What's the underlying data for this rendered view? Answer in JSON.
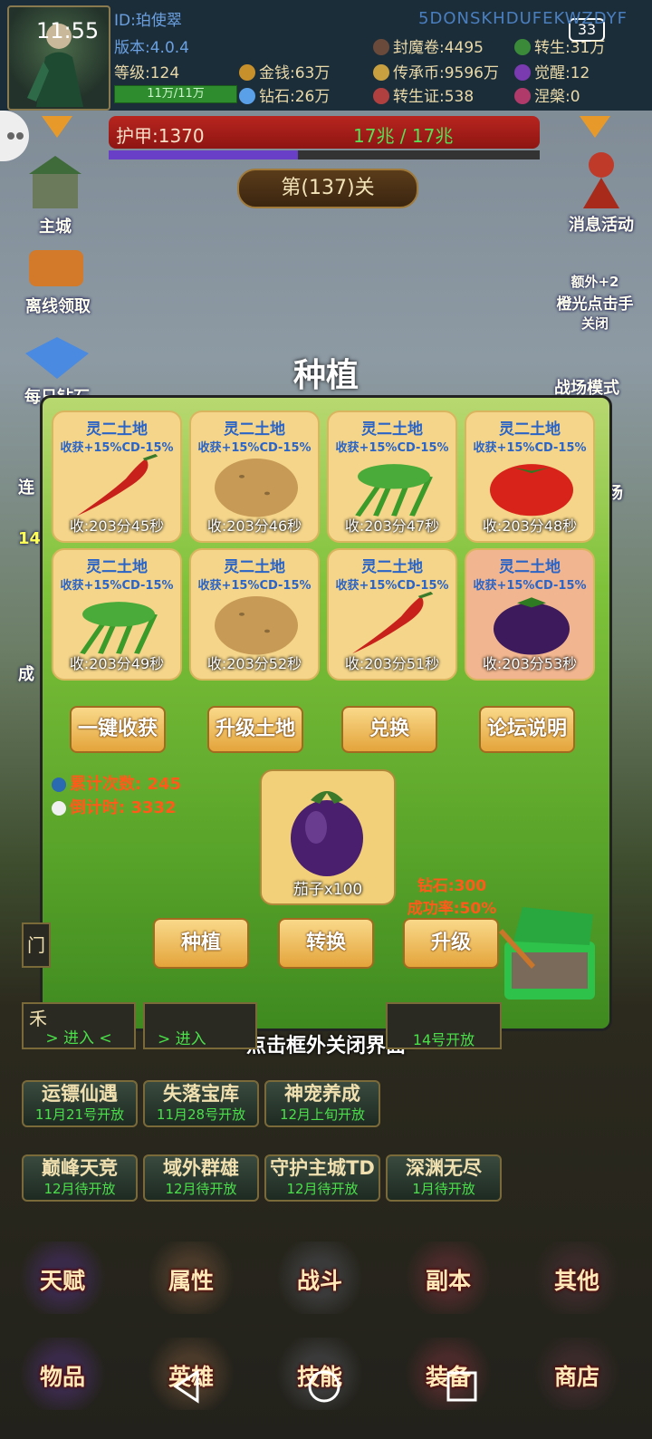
{
  "status_bar": {
    "time": "11:55",
    "battery": "33"
  },
  "player": {
    "id": "ID:珀使翠",
    "uid_code": "5DONSKHDUFEKWZDYF",
    "version": "版本:4.0.4",
    "level": "等级:124",
    "exp": "11万/11万",
    "money": "金钱:63万",
    "diamond": "钻石:26万",
    "seal_scroll": "封魔卷:4495",
    "inherit_coin": "传承币:9596万",
    "rebirth_cert": "转生证:538",
    "rebirth": "转生:31万",
    "awaken": "觉醒:12",
    "nirvana": "涅槃:0"
  },
  "armor": {
    "label": "护甲:1370",
    "hp": "17兆 / 17兆",
    "fill_fraction": 0.44
  },
  "stage": "第(137)关",
  "side_left": [
    "主城",
    "离线领取",
    "每日钻石",
    "连",
    "14",
    "成"
  ],
  "side_right": [
    "消息活动",
    "额外+2",
    "橙光点击手",
    "关闭",
    "战场模式",
    "场"
  ],
  "dialog": {
    "title": "种植",
    "plots": [
      {
        "title": "灵二土地",
        "bonus": "收获+15%CD-15%",
        "time": "收:203分45秒",
        "crop": "chili",
        "bg": "#f4d58a"
      },
      {
        "title": "灵二土地",
        "bonus": "收获+15%CD-15%",
        "time": "收:203分46秒",
        "crop": "potato",
        "bg": "#f4d58a"
      },
      {
        "title": "灵二土地",
        "bonus": "收获+15%CD-15%",
        "time": "收:203分47秒",
        "crop": "greens",
        "bg": "#f4d58a"
      },
      {
        "title": "灵二土地",
        "bonus": "收获+15%CD-15%",
        "time": "收:203分48秒",
        "crop": "tomato",
        "bg": "#f4d58a"
      },
      {
        "title": "灵二土地",
        "bonus": "收获+15%CD-15%",
        "time": "收:203分49秒",
        "crop": "greens",
        "bg": "#f4d58a"
      },
      {
        "title": "灵二土地",
        "bonus": "收获+15%CD-15%",
        "time": "收:203分52秒",
        "crop": "potato",
        "bg": "#f4d58a"
      },
      {
        "title": "灵二土地",
        "bonus": "收获+15%CD-15%",
        "time": "收:203分51秒",
        "crop": "chili",
        "bg": "#f4d58a"
      },
      {
        "title": "灵二土地",
        "bonus": "收获+15%CD-15%",
        "time": "收:203分53秒",
        "crop": "eggplant",
        "bg": "#f1b68f"
      }
    ],
    "action_buttons": [
      "一键收获",
      "升级土地",
      "兑换",
      "论坛说明"
    ],
    "count_label": "累计次数: 245",
    "countdown_label": "倒计时: 3332",
    "seed": "茄子x100",
    "cost_diamond": "钻石:300",
    "success_rate": "成功率:50%",
    "bottom_buttons": [
      "种植",
      "转换",
      "升级"
    ]
  },
  "close_hint": "-点击框外关闭界面-",
  "partial_rows": {
    "enter_left": "> 进入 <",
    "enter_mid": "> 进入",
    "open_right": "14号开放",
    "left_edge_1": "门",
    "left_edge_2": "禾"
  },
  "events": [
    {
      "name": "运镖仙遇",
      "date": "11月21号开放"
    },
    {
      "name": "失落宝库",
      "date": "11月28号开放"
    },
    {
      "name": "神宠养成",
      "date": "12月上旬开放"
    },
    {
      "name": "巅峰天竞",
      "date": "12月待开放"
    },
    {
      "name": "域外群雄",
      "date": "12月待开放"
    },
    {
      "name": "守护主城TD",
      "date": "12月待开放"
    },
    {
      "name": "深渊无尽",
      "date": "1月待开放"
    }
  ],
  "tabs_row1": [
    "天赋",
    "属性",
    "战斗",
    "副本",
    "其他"
  ],
  "tabs_row2": [
    "物品",
    "英雄",
    "技能",
    "装备",
    "商店"
  ]
}
